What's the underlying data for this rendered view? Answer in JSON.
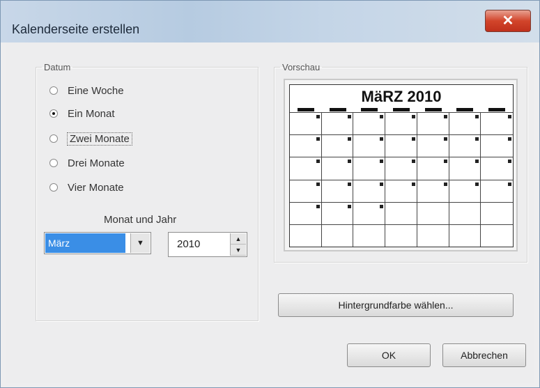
{
  "window": {
    "title": "Kalenderseite erstellen",
    "close_glyph": "✕"
  },
  "datum": {
    "legend": "Datum",
    "options": [
      {
        "label": "Eine Woche",
        "selected": false
      },
      {
        "label": "Ein Monat",
        "selected": true
      },
      {
        "label": "Zwei Monate",
        "selected": false
      },
      {
        "label": "Drei Monate",
        "selected": false
      },
      {
        "label": "Vier Monate",
        "selected": false
      }
    ],
    "month_year_label": "Monat und Jahr",
    "month_value": "März",
    "year_value": "2010"
  },
  "preview": {
    "legend": "Vorschau",
    "calendar_title": "MäRZ 2010",
    "first_day_column": 0,
    "days_in_month": 31
  },
  "buttons": {
    "background": "Hintergrundfarbe wählen...",
    "ok": "OK",
    "cancel": "Abbrechen"
  },
  "icons": {
    "dropdown": "▼",
    "spin_up": "▲",
    "spin_down": "▼"
  }
}
